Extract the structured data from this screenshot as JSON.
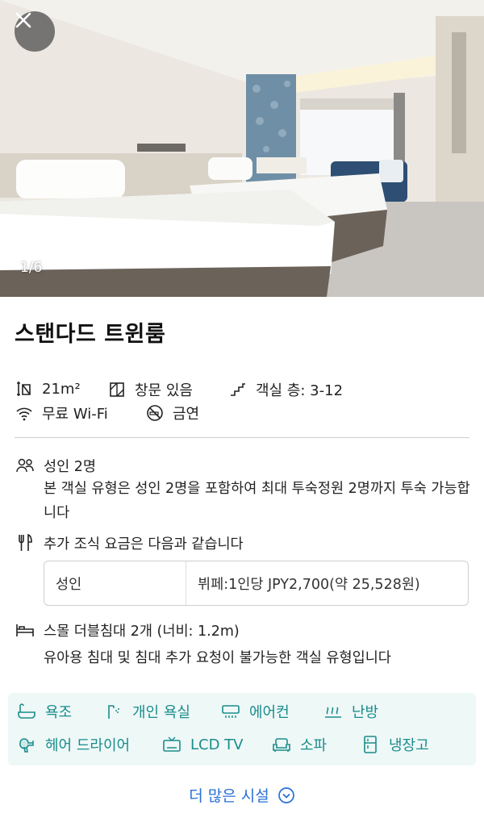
{
  "photo": {
    "counter": "1/6",
    "alt": "hotel-room-photo"
  },
  "room": {
    "title": "스탠다드 트윈룸"
  },
  "features": {
    "size": "21m²",
    "window": "창문 있음",
    "floor": "객실 층: 3-12",
    "wifi": "무료 Wi-Fi",
    "smoking": "금연"
  },
  "occupancy": {
    "label": "성인 2명",
    "description": "본 객실 유형은 성인 2명을 포함하여 최대 투숙정원 2명까지 투숙 가능합니다"
  },
  "breakfast": {
    "label": "추가 조식 요금은 다음과 같습니다",
    "table": {
      "guest_type": "성인",
      "price": "뷔페:1인당 JPY2,700(약 25,528원)"
    }
  },
  "bed": {
    "label": "스몰 더블침대 2개 (너비: 1.2m)",
    "note": "유아용 침대 및 침대 추가 요청이 불가능한 객실 유형입니다"
  },
  "amenities": {
    "items": [
      "욕조",
      "개인 욕실",
      "에어컨",
      "난방",
      "헤어 드라이어",
      "LCD TV",
      "소파",
      "냉장고"
    ],
    "color": "#1a8c8c",
    "background": "#eef8f7"
  },
  "more_button": {
    "label": "더 많은 시설",
    "color": "#2a6fd6"
  }
}
